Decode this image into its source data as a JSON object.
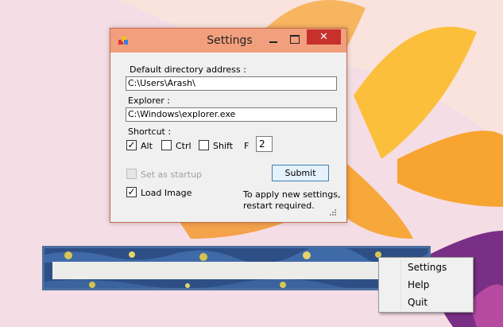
{
  "window": {
    "title": "Settings",
    "close_glyph": "✕",
    "icons": {
      "app": "app-icon",
      "minimize": "minimize-icon",
      "maximize": "maximize-icon",
      "close": "close-icon"
    }
  },
  "form": {
    "default_dir_label": "Default directory address :",
    "default_dir_value": "C:\\Users\\Arash\\",
    "explorer_label": "Explorer :",
    "explorer_value": "C:\\Windows\\explorer.exe",
    "shortcut_label": "Shortcut :",
    "alt": {
      "label": "Alt",
      "checked": true
    },
    "ctrl": {
      "label": "Ctrl",
      "checked": false
    },
    "shift": {
      "label": "Shift",
      "checked": false
    },
    "f_label": "F",
    "f_value": "2",
    "startup": {
      "label": "Set as startup",
      "checked": false,
      "enabled": false
    },
    "load_image": {
      "label": "Load Image",
      "checked": true
    },
    "submit_label": "Submit",
    "note_line1": "To apply new settings,",
    "note_line2": "restart required."
  },
  "context_menu": {
    "items": [
      "Settings",
      "Help",
      "Quit"
    ]
  },
  "colors": {
    "titlebar": "#f29f7d",
    "close_button": "#c7302c",
    "window_bg": "#f0f0f0",
    "strip_border": "#4a6fa0"
  }
}
